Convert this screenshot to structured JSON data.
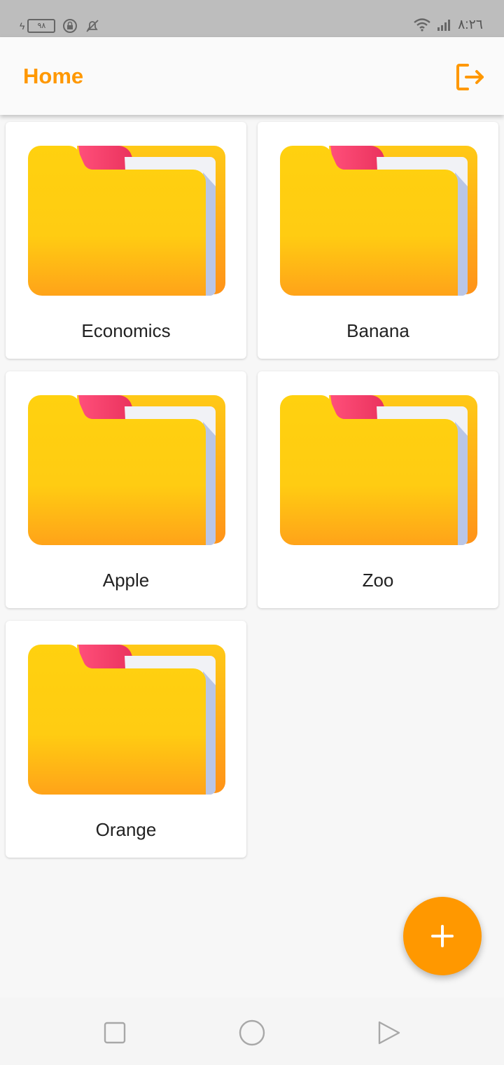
{
  "status_bar": {
    "battery_level": "٩٨",
    "time": "٨:٢٦",
    "icons": [
      "battery-icon",
      "lock-rotation-icon",
      "bell-off-icon",
      "wifi-icon",
      "signal-icon"
    ]
  },
  "app_bar": {
    "title": "Home",
    "action_icon": "logout-icon"
  },
  "folders": [
    {
      "label": "Economics"
    },
    {
      "label": "Banana"
    },
    {
      "label": "Apple"
    },
    {
      "label": "Zoo"
    },
    {
      "label": "Orange"
    }
  ],
  "fab": {
    "icon": "plus-icon"
  },
  "nav_bar": {
    "icons": [
      "recent-apps-icon",
      "home-icon",
      "back-icon"
    ]
  },
  "colors": {
    "accent": "#ff9800",
    "status_bar_bg": "#bdbdbd",
    "folder_yellow": "#ffd012",
    "folder_tab": "#f23e6a"
  }
}
